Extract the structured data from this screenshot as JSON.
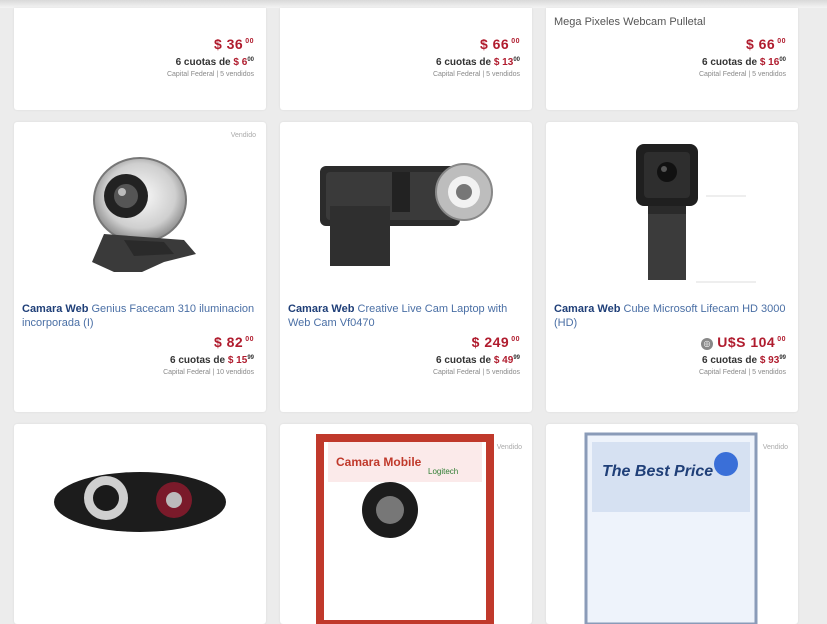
{
  "products_top": [
    {
      "title": "",
      "price_main": "$ 36",
      "price_cents": "00",
      "install_prefix": "6 cuotas de",
      "install_amount": "$ 6",
      "install_cents": "00",
      "seller": "Capital Federal | 5 vendidos"
    },
    {
      "title": "",
      "price_main": "$ 66",
      "price_cents": "00",
      "install_prefix": "6 cuotas de",
      "install_amount": "$ 13",
      "install_cents": "00",
      "seller": "Capital Federal | 5 vendidos"
    },
    {
      "title": "Mega Pixeles Webcam Pulletal",
      "price_main": "$ 66",
      "price_cents": "00",
      "install_prefix": "6 cuotas de",
      "install_amount": "$ 16",
      "install_cents": "00",
      "seller": "Capital Federal | 5 vendidos"
    }
  ],
  "products_mid": [
    {
      "badge": "Vendido",
      "title_bold": "Camara Web",
      "title_rest": "Genius Facecam 310 iluminacion incorporada (I)",
      "price_main": "$ 82",
      "price_cents": "00",
      "install_prefix": "6 cuotas de",
      "install_amount": "$ 15",
      "install_cents": "99",
      "seller": "Capital Federal | 10 vendidos"
    },
    {
      "badge": "",
      "title_bold": "Camara Web",
      "title_rest": "Creative Live Cam Laptop with Web Cam Vf0470",
      "price_main": "$ 249",
      "price_cents": "00",
      "install_prefix": "6 cuotas de",
      "install_amount": "$ 49",
      "install_cents": "99",
      "seller": "Capital Federal | 5 vendidos"
    },
    {
      "badge": "",
      "title_bold": "Camara Web",
      "title_rest": "Cube Microsoft Lifecam HD 3000 (HD)",
      "currency_icon": "globe-icon",
      "price_main": "U$S 104",
      "price_cents": "00",
      "install_prefix": "6 cuotas de",
      "install_amount": "$ 93",
      "install_cents": "99",
      "seller": "Capital Federal | 5 vendidos"
    }
  ],
  "products_bottom": [
    {
      "badge": ""
    },
    {
      "badge": "Vendido",
      "box_text": "Camara Mobile",
      "brand": "Logitech"
    },
    {
      "badge": "Vendido",
      "box_text": "The Best Price"
    }
  ],
  "colors": {
    "price": "#b01c2e",
    "title_bold": "#1f3f78",
    "title": "#4a6fa5"
  }
}
